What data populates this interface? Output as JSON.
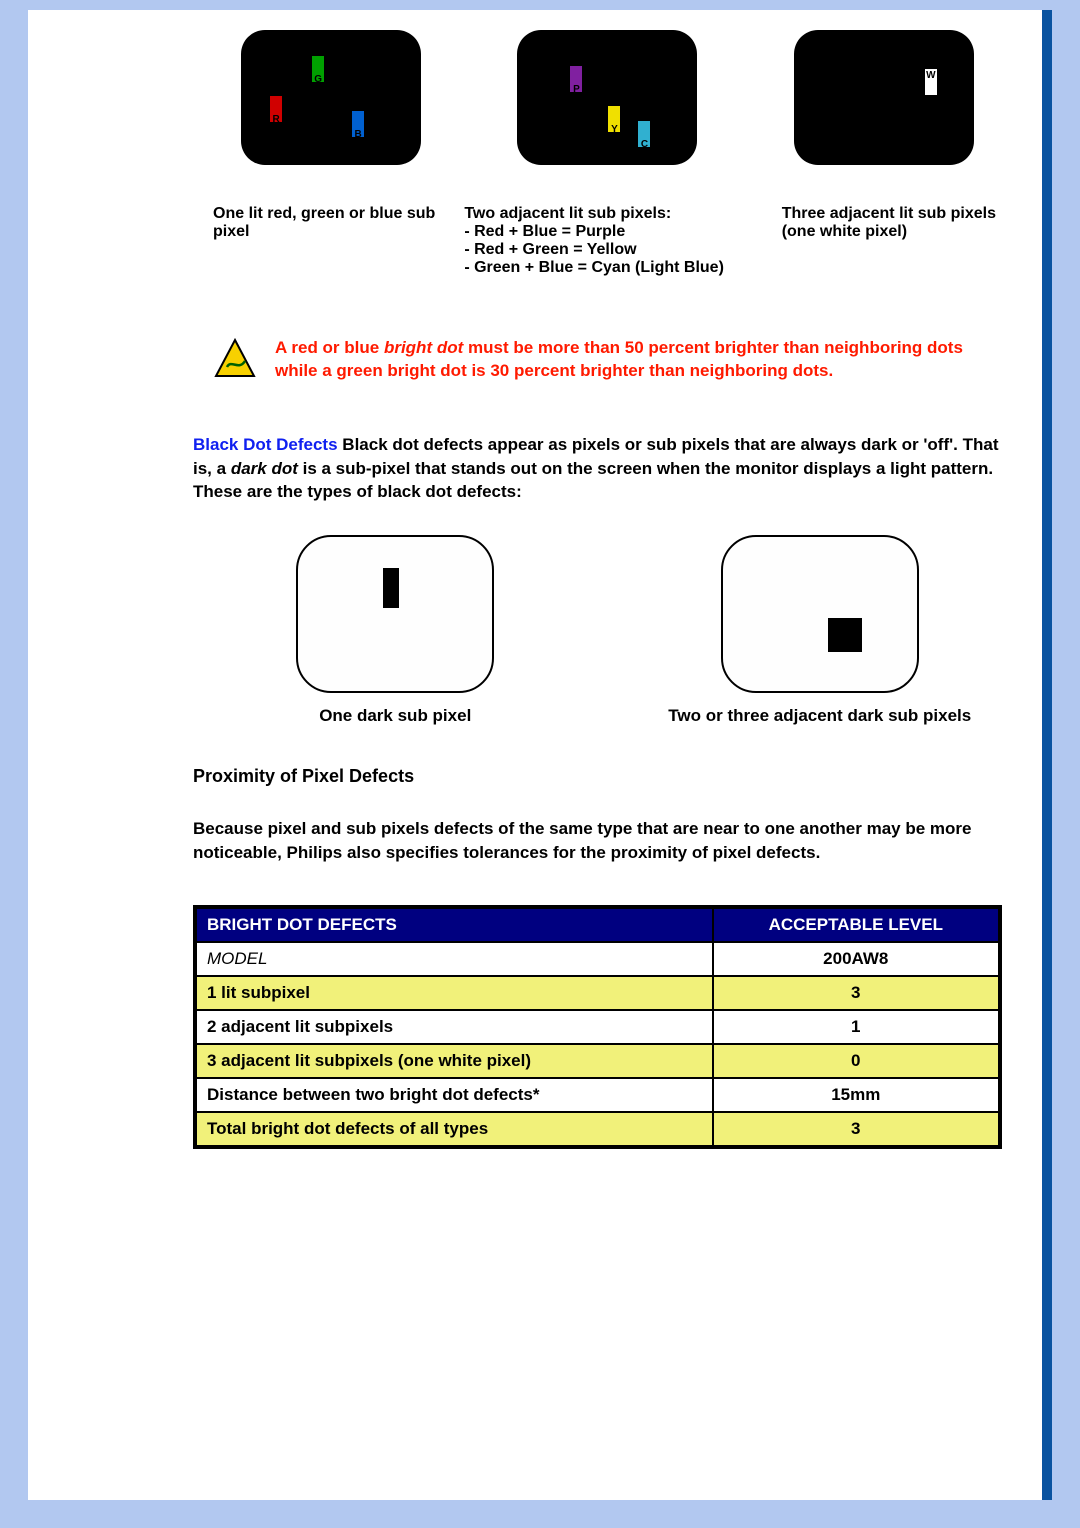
{
  "subpixel_labels": {
    "R": "R",
    "G": "G",
    "B": "B",
    "P": "P",
    "Y": "Y",
    "C": "C",
    "W": "W"
  },
  "captions": {
    "c1": "One lit red, green or blue sub pixel",
    "c2_head": "Two adjacent lit sub pixels:",
    "c2_l1": "- Red + Blue = Purple",
    "c2_l2": "- Red + Green = Yellow",
    "c2_l3": "- Green + Blue = Cyan (Light Blue)",
    "c3": "Three adjacent lit sub pixels (one white pixel)"
  },
  "note": {
    "part1": "A red or blue ",
    "italic1": "bright dot",
    "part2": " must be more than 50 percent brighter than neighboring dots while a green bright dot is 30 percent brighter than neighboring dots."
  },
  "blackdot": {
    "lead_blue": "Black Dot Defects",
    "lead_rest_a": " Black dot defects appear as pixels or sub pixels that are always dark or 'off'. That is, a ",
    "lead_italic": "dark dot",
    "lead_rest_b": " is a sub-pixel that stands out on the screen when the monitor displays a light pattern. These are the types of black dot defects:",
    "cap1": "One dark sub pixel",
    "cap2": "Two or three adjacent dark sub pixels"
  },
  "proximity": {
    "head": "Proximity of Pixel Defects",
    "text": "Because pixel and sub pixels defects of the same type that are near to one another may be more noticeable, Philips also specifies tolerances for the proximity of pixel defects."
  },
  "table": {
    "h1": "BRIGHT DOT DEFECTS",
    "h2": "ACCEPTABLE LEVEL",
    "rows": [
      {
        "label": "MODEL",
        "value": "200AW8",
        "yellow": false,
        "model": true
      },
      {
        "label": "1 lit subpixel",
        "value": "3",
        "yellow": true
      },
      {
        "label": "2 adjacent lit subpixels",
        "value": "1",
        "yellow": false
      },
      {
        "label": "3 adjacent lit subpixels (one white pixel)",
        "value": "0",
        "yellow": true
      },
      {
        "label": "Distance between two bright dot defects*",
        "value": "15mm",
        "yellow": false
      },
      {
        "label": "Total bright dot defects of all types",
        "value": "3",
        "yellow": true
      }
    ]
  }
}
